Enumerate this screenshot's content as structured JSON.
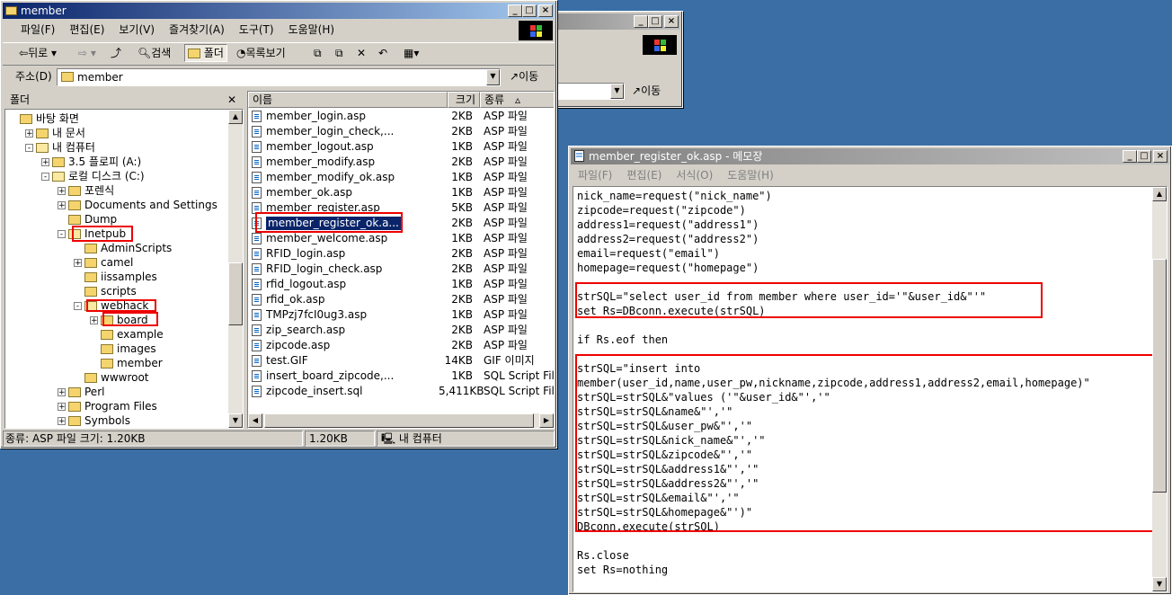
{
  "explorer": {
    "title": "member",
    "menu": [
      "파일(F)",
      "편집(E)",
      "보기(V)",
      "즐겨찾기(A)",
      "도구(T)",
      "도움말(H)"
    ],
    "toolbar": {
      "back": "뒤로",
      "search": "검색",
      "folders": "폴더",
      "history": "목록보기"
    },
    "address_label": "주소(D)",
    "address_value": "member",
    "go_label": "이동",
    "folder_pane_title": "폴더",
    "tree": [
      {
        "label": "바탕 화면",
        "level": 0
      },
      {
        "label": "내 문서",
        "level": 1
      },
      {
        "label": "내 컴퓨터",
        "level": 1
      },
      {
        "label": "3.5 플로피 (A:)",
        "level": 2
      },
      {
        "label": "로컬 디스크 (C:)",
        "level": 2
      },
      {
        "label": "포렌식",
        "level": 3
      },
      {
        "label": "Documents and Settings",
        "level": 3
      },
      {
        "label": "Dump",
        "level": 3
      },
      {
        "label": "Inetpub",
        "level": 3
      },
      {
        "label": "AdminScripts",
        "level": 4
      },
      {
        "label": "camel",
        "level": 4
      },
      {
        "label": "iissamples",
        "level": 4
      },
      {
        "label": "scripts",
        "level": 4
      },
      {
        "label": "webhack",
        "level": 4
      },
      {
        "label": "board",
        "level": 5
      },
      {
        "label": "example",
        "level": 5
      },
      {
        "label": "images",
        "level": 5
      },
      {
        "label": "member",
        "level": 5
      },
      {
        "label": "wwwroot",
        "level": 4
      },
      {
        "label": "Perl",
        "level": 3
      },
      {
        "label": "Program Files",
        "level": 3
      },
      {
        "label": "Symbols",
        "level": 3
      }
    ],
    "columns": {
      "name": "이름",
      "size": "크기",
      "type": "종류"
    },
    "files": [
      {
        "name": "member_login.asp",
        "size": "2KB",
        "type": "ASP 파일"
      },
      {
        "name": "member_login_check,...",
        "size": "2KB",
        "type": "ASP 파일"
      },
      {
        "name": "member_logout.asp",
        "size": "1KB",
        "type": "ASP 파일"
      },
      {
        "name": "member_modify.asp",
        "size": "2KB",
        "type": "ASP 파일"
      },
      {
        "name": "member_modify_ok.asp",
        "size": "1KB",
        "type": "ASP 파일"
      },
      {
        "name": "member_ok.asp",
        "size": "1KB",
        "type": "ASP 파일"
      },
      {
        "name": "member_register.asp",
        "size": "5KB",
        "type": "ASP 파일"
      },
      {
        "name": "member_register_ok.a...",
        "size": "2KB",
        "type": "ASP 파일"
      },
      {
        "name": "member_welcome.asp",
        "size": "1KB",
        "type": "ASP 파일"
      },
      {
        "name": "RFID_login.asp",
        "size": "2KB",
        "type": "ASP 파일"
      },
      {
        "name": "RFID_login_check.asp",
        "size": "2KB",
        "type": "ASP 파일"
      },
      {
        "name": "rfid_logout.asp",
        "size": "1KB",
        "type": "ASP 파일"
      },
      {
        "name": "rfid_ok.asp",
        "size": "2KB",
        "type": "ASP 파일"
      },
      {
        "name": "TMPzj7fcI0ug3.asp",
        "size": "1KB",
        "type": "ASP 파일"
      },
      {
        "name": "zip_search.asp",
        "size": "2KB",
        "type": "ASP 파일"
      },
      {
        "name": "zipcode.asp",
        "size": "2KB",
        "type": "ASP 파일"
      },
      {
        "name": "test.GIF",
        "size": "14KB",
        "type": "GIF 이미지"
      },
      {
        "name": "insert_board_zipcode,...",
        "size": "1KB",
        "type": "SQL Script Fil"
      },
      {
        "name": "zipcode_insert.sql",
        "size": "5,411KB",
        "type": "SQL Script Fil"
      }
    ],
    "status": {
      "left": "종류: ASP 파일 크기: 1.20KB",
      "size": "1.20KB",
      "computer": "내 컴퓨터"
    }
  },
  "back_window": {
    "go_label": "이동"
  },
  "notepad": {
    "title": "member_register_ok.asp - 메모장",
    "menu": [
      "파일(F)",
      "편집(E)",
      "서식(O)",
      "도움말(H)"
    ],
    "lines": [
      "nick_name=request(\"nick_name\")",
      "zipcode=request(\"zipcode\")",
      "address1=request(\"address1\")",
      "address2=request(\"address2\")",
      "email=request(\"email\")",
      "homepage=request(\"homepage\")",
      "",
      "strSQL=\"select user_id from member where user_id='\"&user_id&\"'\"",
      "set Rs=DBconn.execute(strSQL)",
      "",
      "if Rs.eof then",
      "",
      "strSQL=\"insert into",
      "member(user_id,name,user_pw,nickname,zipcode,address1,address2,email,homepage)\"",
      "strSQL=strSQL&\"values ('\"&user_id&\"','\"",
      "strSQL=strSQL&name&\"','\"",
      "strSQL=strSQL&user_pw&\"','\"",
      "strSQL=strSQL&nick_name&\"','\"",
      "strSQL=strSQL&zipcode&\"','\"",
      "strSQL=strSQL&address1&\"','\"",
      "strSQL=strSQL&address2&\"','\"",
      "strSQL=strSQL&email&\"','\"",
      "strSQL=strSQL&homepage&\"')\"",
      "DBconn.execute(strSQL)",
      "",
      "Rs.close",
      "set Rs=nothing"
    ]
  }
}
